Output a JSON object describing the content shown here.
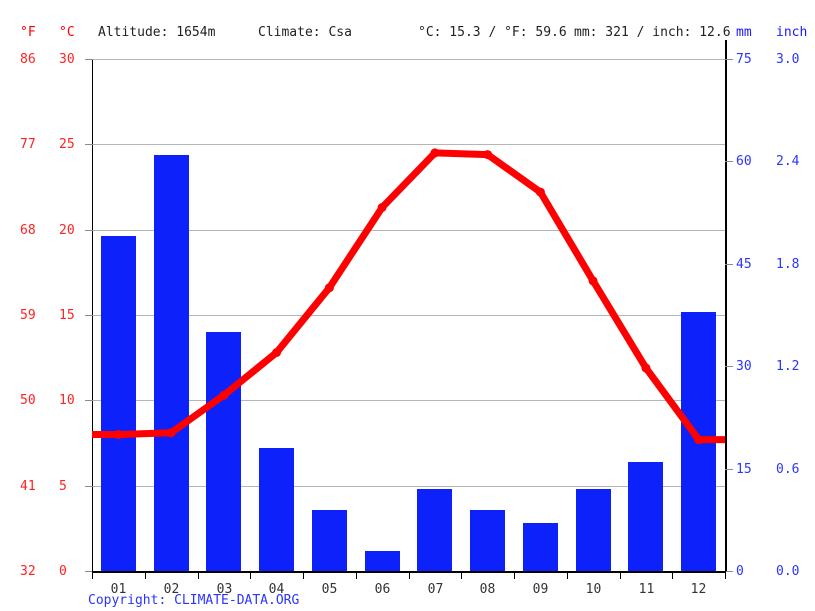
{
  "header": {
    "f_label": "°F",
    "c_label": "°C",
    "altitude": "Altitude: 1654m",
    "climate": "Climate: Csa",
    "temperature_summary": "°C: 15.3 / °F: 59.6",
    "precipitation_summary": "mm: 321 / inch: 12.6",
    "mm_label": "mm",
    "inch_label": "inch"
  },
  "footer": {
    "copyright": "Copyright: CLIMATE-DATA.ORG"
  },
  "colors": {
    "temperature_line": "#ff0000",
    "precipitation_bar": "#0d22fa",
    "left_axis_text": "#ff2222",
    "right_axis_text": "#2b35ff",
    "gridline": "#b5b5b5"
  },
  "chart_data": {
    "type": "bar",
    "title": "",
    "subtitle": "",
    "xlabel": "",
    "categories": [
      "01",
      "02",
      "03",
      "04",
      "05",
      "06",
      "07",
      "08",
      "09",
      "10",
      "11",
      "12"
    ],
    "axes": {
      "left_fahrenheit": {
        "label": "°F",
        "ticks": [
          "32",
          "41",
          "50",
          "59",
          "68",
          "77",
          "86"
        ],
        "range": [
          32,
          86
        ]
      },
      "left_celsius": {
        "label": "°C",
        "ticks": [
          "0",
          "5",
          "10",
          "15",
          "20",
          "25",
          "30"
        ],
        "range": [
          0,
          30
        ]
      },
      "right_mm": {
        "label": "mm",
        "ticks": [
          "0",
          "15",
          "30",
          "45",
          "60",
          "75"
        ],
        "range": [
          0,
          75
        ]
      },
      "right_inch": {
        "label": "inch",
        "ticks": [
          "0.0",
          "0.6",
          "1.2",
          "1.8",
          "2.4",
          "3.0"
        ],
        "range": [
          0.0,
          3.0
        ]
      },
      "grid": true,
      "legend": "none"
    },
    "series": [
      {
        "name": "Precipitation",
        "unit": "mm",
        "type": "bar",
        "color": "#0d22fa",
        "values": [
          49,
          61,
          35,
          18,
          9,
          3,
          12,
          9,
          7,
          12,
          16,
          38
        ]
      },
      {
        "name": "Temperature",
        "unit": "°C",
        "type": "line",
        "color": "#ff0000",
        "values": [
          8.0,
          8.1,
          10.3,
          12.8,
          16.6,
          21.3,
          24.5,
          24.4,
          22.2,
          17.0,
          11.9,
          7.7
        ]
      }
    ]
  }
}
